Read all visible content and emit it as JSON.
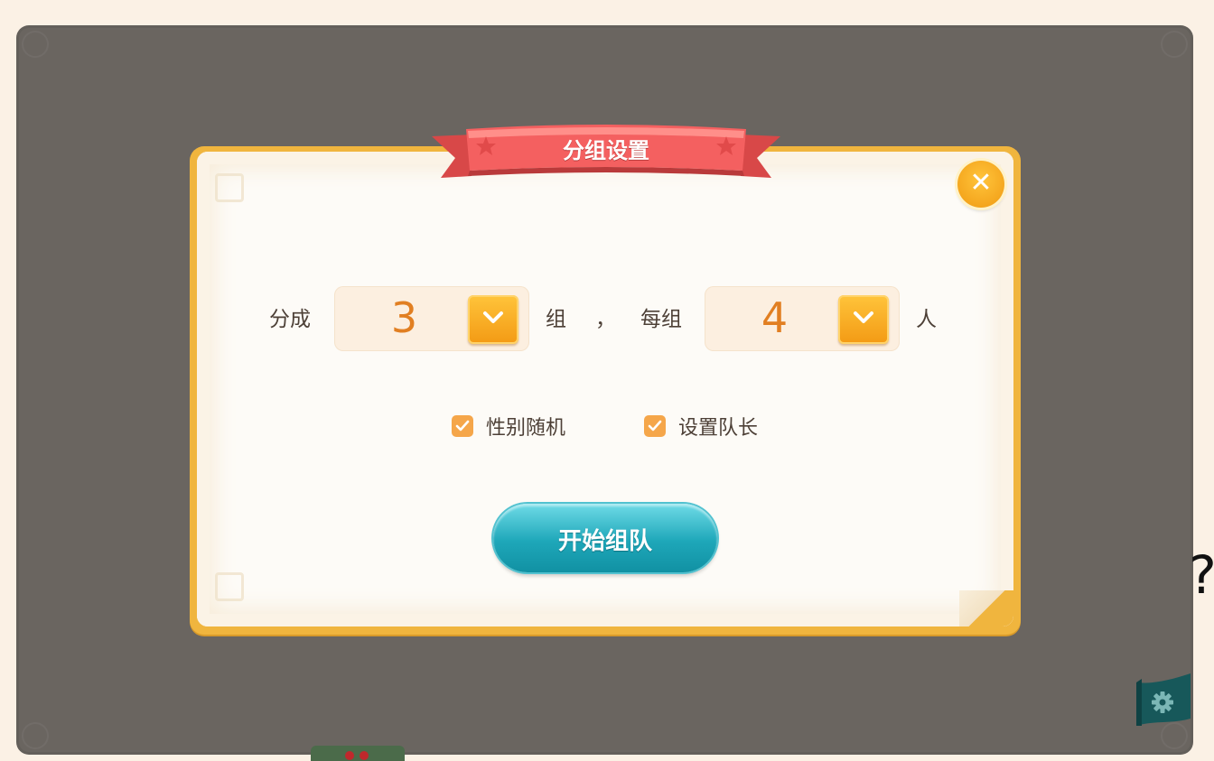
{
  "dialog": {
    "title": "分组设置",
    "close_icon": "close-icon",
    "split_label": "分成",
    "group_count": "3",
    "group_unit": "组",
    "separator": "，",
    "per_group_label": "每组",
    "per_group_count": "4",
    "person_unit": "人",
    "options": [
      {
        "label": "性别随机",
        "checked": true
      },
      {
        "label": "设置队长",
        "checked": true
      }
    ],
    "start_button": "开始组队"
  },
  "page": {
    "help_mark": "?",
    "settings_icon": "gear-icon"
  },
  "colors": {
    "overlay": "#6a6560",
    "dialog_border": "#f0b53e",
    "ribbon": "#f25c5c",
    "accent_orange": "#f39a14",
    "value_text": "#e17f22",
    "checkbox": "#f5a64a",
    "start_button": "#1ea7b9"
  }
}
